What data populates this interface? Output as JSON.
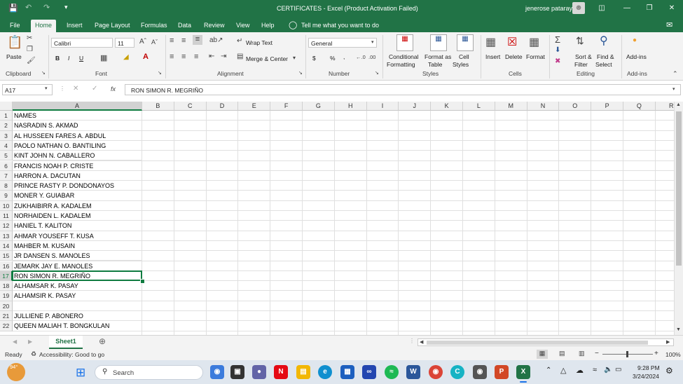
{
  "titlebar": {
    "title": "CERTIFICATES  -  Excel (Product Activation Failed)",
    "user": "jenerose pataray",
    "qat_icons": [
      "save-icon",
      "undo-icon",
      "redo-icon",
      "customize-icon"
    ]
  },
  "tabs": [
    "File",
    "Home",
    "Insert",
    "Page Layout",
    "Formulas",
    "Data",
    "Review",
    "View",
    "Help"
  ],
  "active_tab": "Home",
  "tell_me": "Tell me what you want to do",
  "ribbon": {
    "clipboard": {
      "paste": "Paste",
      "label": "Clipboard"
    },
    "font": {
      "name": "Calibri",
      "size": "11",
      "label": "Font",
      "bold": "B",
      "italic": "I",
      "underline": "U"
    },
    "alignment": {
      "wrap": "Wrap Text",
      "merge": "Merge & Center",
      "label": "Alignment"
    },
    "number": {
      "format": "General",
      "currency": "$",
      "percent": "%",
      "comma": ",",
      "label": "Number"
    },
    "styles": {
      "conditional_1": "Conditional",
      "conditional_2": "Formatting",
      "format_table_1": "Format as",
      "format_table_2": "Table",
      "cell_styles_1": "Cell",
      "cell_styles_2": "Styles",
      "label": "Styles"
    },
    "cells": {
      "insert": "Insert",
      "delete": "Delete",
      "format": "Format",
      "label": "Cells"
    },
    "editing": {
      "sort_1": "Sort &",
      "sort_2": "Filter",
      "find_1": "Find &",
      "find_2": "Select",
      "label": "Editing"
    },
    "addins": {
      "addins": "Add-ins",
      "label": "Add-ins"
    }
  },
  "formula_bar": {
    "name_box": "A17",
    "fx": "fx",
    "content": "RON SIMON R. MEGRIÑO"
  },
  "columns": [
    "A",
    "B",
    "C",
    "D",
    "E",
    "F",
    "G",
    "H",
    "I",
    "J",
    "K",
    "L",
    "M",
    "N",
    "O",
    "P",
    "Q",
    "R"
  ],
  "rows": [
    {
      "n": "1",
      "a": "NAMES"
    },
    {
      "n": "2",
      "a": "NASRADIN S. AKMAD"
    },
    {
      "n": "3",
      "a": "AL HUSSEEN FARES A. ABDUL"
    },
    {
      "n": "4",
      "a": "PAOLO NATHAN O. BANTILING"
    },
    {
      "n": "5",
      "a": "KINT JOHN N. CABALLERO"
    },
    {
      "n": "6",
      "a": "FRANCIS NOAH P. CRISTE"
    },
    {
      "n": "7",
      "a": "HARRON A. DACUTAN"
    },
    {
      "n": "8",
      "a": "PRINCE  RASTY P. DONDONAYOS"
    },
    {
      "n": "9",
      "a": "MONER Y. GUIABAR"
    },
    {
      "n": "10",
      "a": "ZUKHAIBIRR A. KADALEM"
    },
    {
      "n": "11",
      "a": "NORHAIDEN L. KADALEM"
    },
    {
      "n": "12",
      "a": "HANIEL T. KALITON"
    },
    {
      "n": "13",
      "a": "AHMAR YOUSEFF T. KUSA"
    },
    {
      "n": "14",
      "a": "MAHBER M. KUSAIN"
    },
    {
      "n": "15",
      "a": "JR DANSEN S. MANOLES"
    },
    {
      "n": "16",
      "a": "JEMARK JAY E. MANOLES"
    },
    {
      "n": "17",
      "a": "RON SIMON R. MEGRIÑO"
    },
    {
      "n": "18",
      "a": "ALHAMSAR K. PASAY"
    },
    {
      "n": "19",
      "a": "ALHAMSIR K. PASAY"
    },
    {
      "n": "20",
      "a": ""
    },
    {
      "n": "21",
      "a": "JULLIENE P. ABONERO"
    },
    {
      "n": "22",
      "a": "QUEEN MALIAH T. BONGKULAN"
    }
  ],
  "selected_row": "17",
  "sheet_tab": "Sheet1",
  "status": {
    "ready": "Ready",
    "accessibility": "Accessibility: Good to go",
    "zoom": "100%"
  },
  "taskbar": {
    "weather_temp": "94°",
    "search_placeholder": "Search",
    "time": "9:28 PM",
    "date": "3/24/2024"
  },
  "colors": {
    "excel_green": "#217346",
    "selection": "#107c41"
  }
}
